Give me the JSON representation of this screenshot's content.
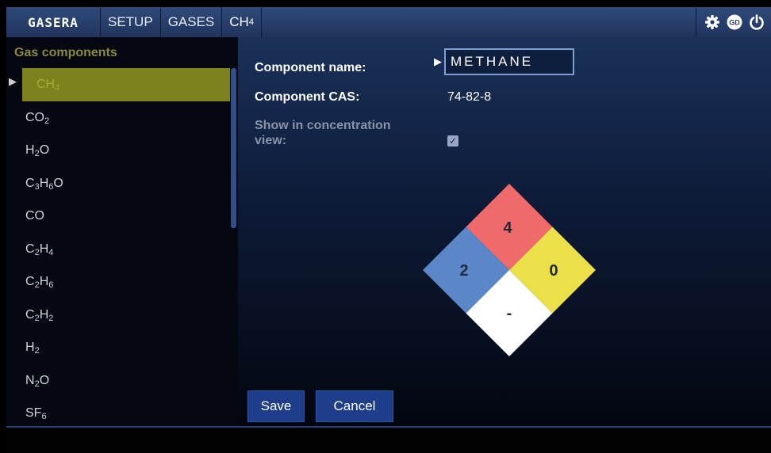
{
  "topbar": {
    "logo": "GASERA",
    "tabs": [
      "SETUP",
      "GASES"
    ],
    "current_tab": {
      "base": "CH",
      "sub": "4"
    },
    "icons": [
      "gear-icon",
      "gd-icon",
      "power-icon"
    ]
  },
  "sidebar": {
    "title": "Gas components",
    "items": [
      {
        "parts": [
          [
            "CH",
            ""
          ],
          [
            "4",
            "sub"
          ]
        ],
        "selected": true
      },
      {
        "parts": [
          [
            "CO",
            ""
          ],
          [
            "2",
            "sub"
          ]
        ]
      },
      {
        "parts": [
          [
            "H",
            ""
          ],
          [
            "2",
            "sub"
          ],
          [
            "O",
            ""
          ]
        ]
      },
      {
        "parts": [
          [
            "C",
            ""
          ],
          [
            "3",
            "sub"
          ],
          [
            "H",
            ""
          ],
          [
            "6",
            "sub"
          ],
          [
            "O",
            ""
          ]
        ]
      },
      {
        "parts": [
          [
            "CO",
            ""
          ]
        ]
      },
      {
        "parts": [
          [
            "C",
            ""
          ],
          [
            "2",
            "sub"
          ],
          [
            "H",
            ""
          ],
          [
            "4",
            "sub"
          ]
        ]
      },
      {
        "parts": [
          [
            "C",
            ""
          ],
          [
            "2",
            "sub"
          ],
          [
            "H",
            ""
          ],
          [
            "6",
            "sub"
          ]
        ]
      },
      {
        "parts": [
          [
            "C",
            ""
          ],
          [
            "2",
            "sub"
          ],
          [
            "H",
            ""
          ],
          [
            "2",
            "sub"
          ]
        ]
      },
      {
        "parts": [
          [
            "H",
            ""
          ],
          [
            "2",
            "sub"
          ]
        ]
      },
      {
        "parts": [
          [
            "N",
            ""
          ],
          [
            "2",
            "sub"
          ],
          [
            "O",
            ""
          ]
        ]
      },
      {
        "parts": [
          [
            "SF",
            ""
          ],
          [
            "6",
            "sub"
          ]
        ]
      }
    ]
  },
  "form": {
    "name_label": "Component name:",
    "name_value": "METHANE",
    "cas_label": "Component CAS:",
    "cas_value": "74-82-8",
    "show_label_line1": "Show in concentration",
    "show_label_line2": "view:",
    "show_checked": true,
    "checkmark": "✓"
  },
  "nfpa": {
    "fire": "4",
    "health": "2",
    "reactivity": "0",
    "special": "-",
    "colors": {
      "fire": "#ef6b6b",
      "health": "#5b86c8",
      "reactivity": "#ece04a",
      "special": "#ffffff"
    }
  },
  "buttons": {
    "save": "Save",
    "cancel": "Cancel"
  }
}
